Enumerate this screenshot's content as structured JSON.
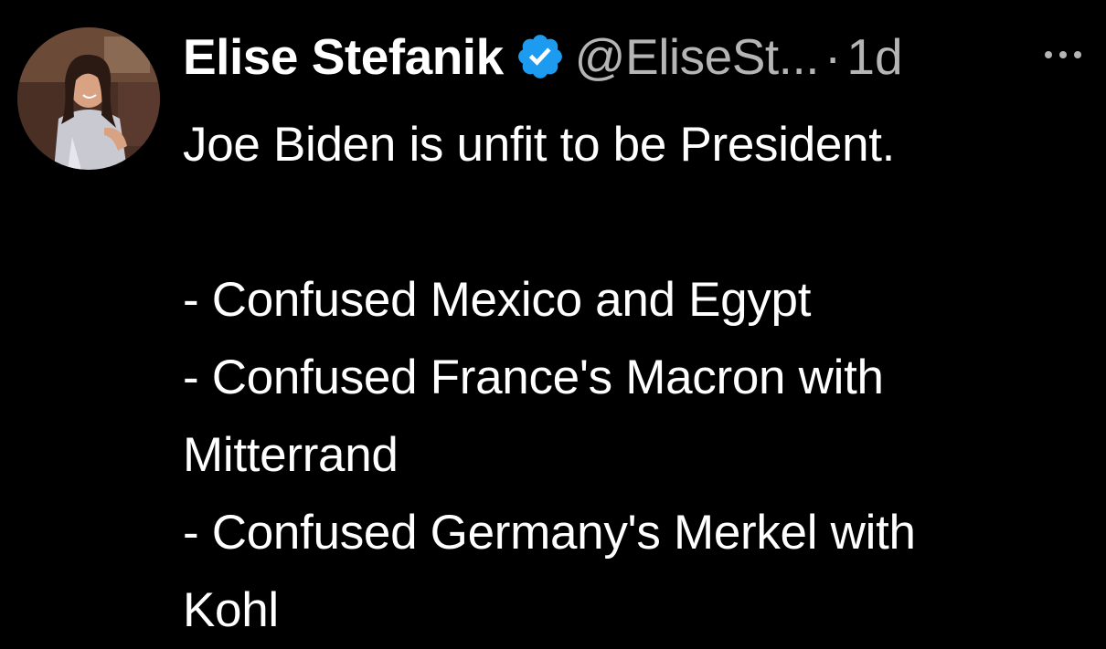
{
  "tweet": {
    "display_name": "Elise Stefanik",
    "handle": "@EliseSt...",
    "separator": "·",
    "timestamp": "1d",
    "verified_color": "#1d9bf0",
    "avatar_icon": "profile-photo",
    "more_icon": "more-horizontal-icon",
    "text_lines": [
      "Joe Biden is unfit to be President.",
      "",
      "- Confused Mexico and Egypt",
      "- Confused France's Macron with",
      "Mitterrand",
      "- Confused Germany's Merkel with",
      "Kohl"
    ]
  },
  "colors": {
    "background": "#000000",
    "primary_text": "#ffffff",
    "secondary_text": "#b5b5b5"
  }
}
